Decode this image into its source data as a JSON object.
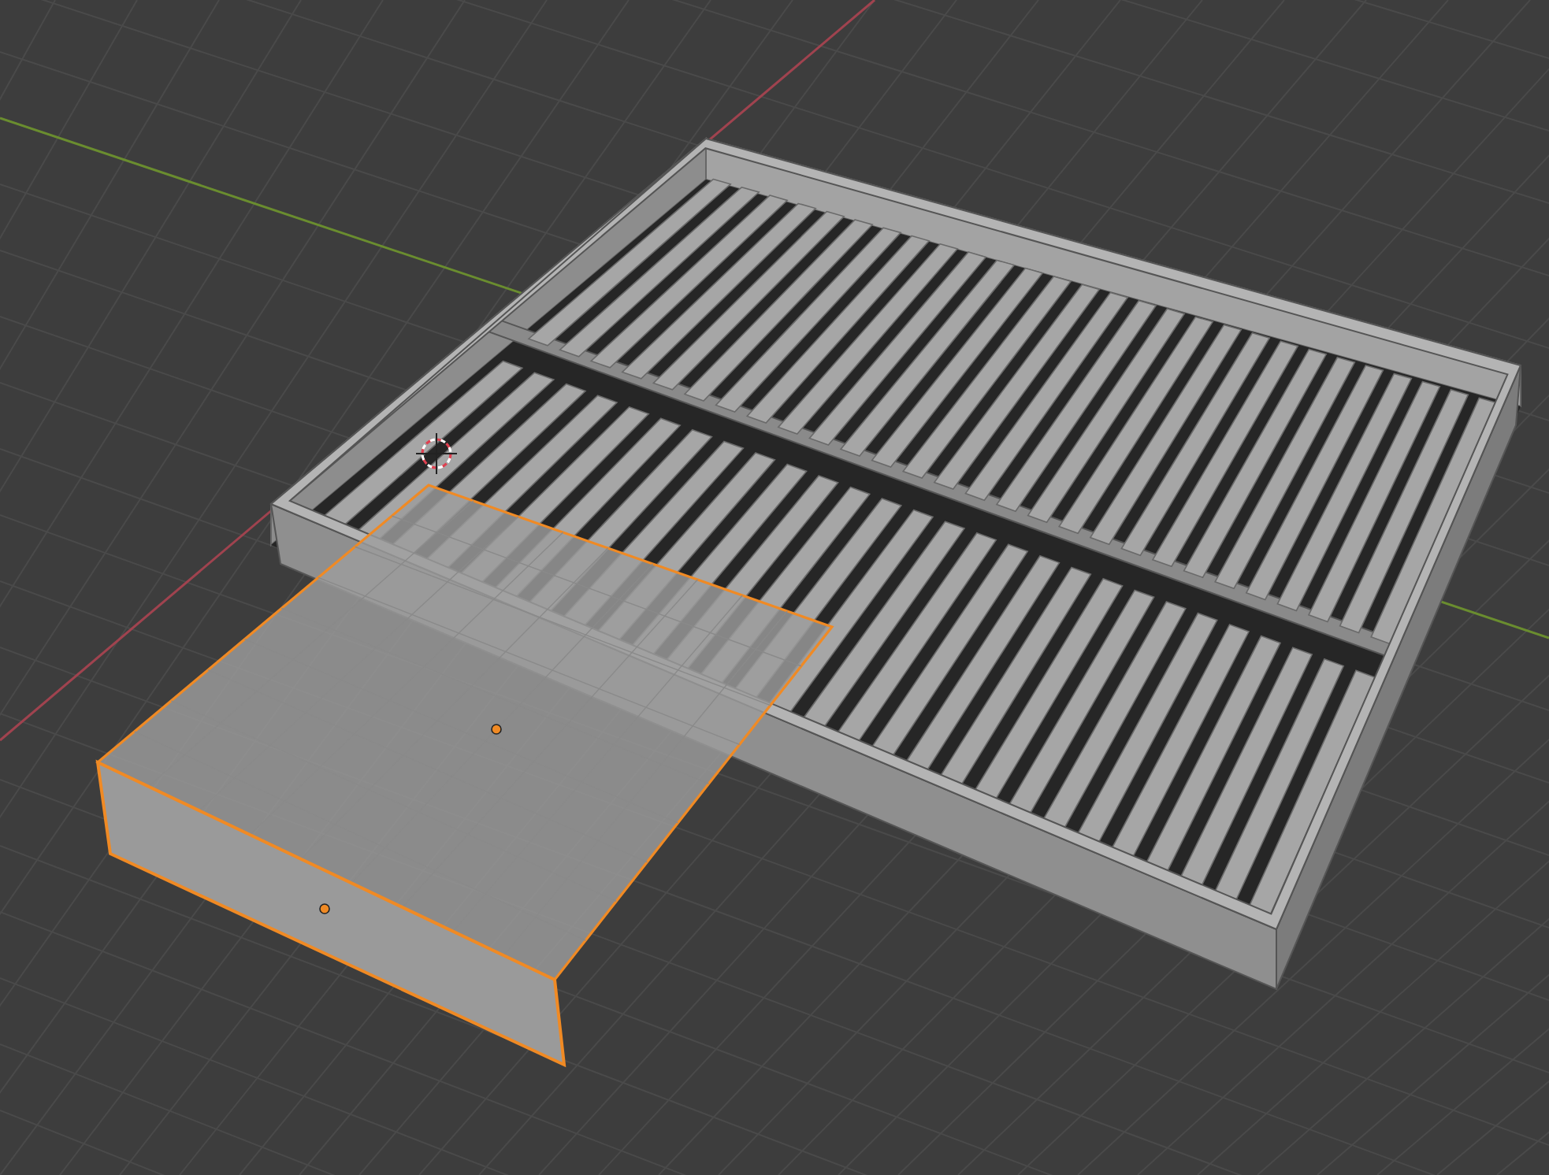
{
  "viewport": {
    "objects": [
      {
        "kind": "bed_frame",
        "selected": false
      },
      {
        "kind": "drawer",
        "selected": true
      }
    ]
  }
}
